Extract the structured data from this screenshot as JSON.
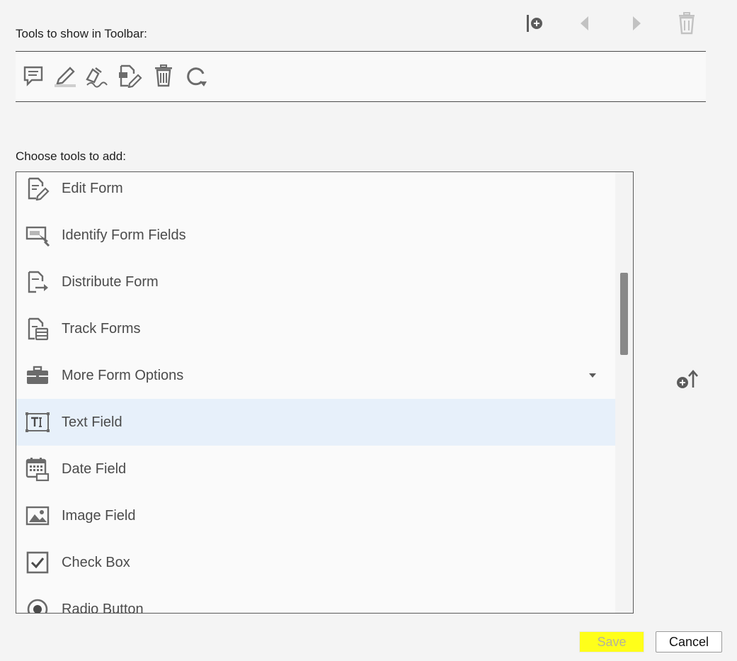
{
  "toolbar_section": {
    "label": "Tools to show in Toolbar:"
  },
  "top_actions": [
    {
      "name": "add-separator-icon",
      "enabled": true
    },
    {
      "name": "move-left-icon",
      "enabled": false
    },
    {
      "name": "move-right-icon",
      "enabled": false
    },
    {
      "name": "delete-icon",
      "enabled": false
    }
  ],
  "toolbar_tools": [
    "comment-icon",
    "highlight-icon",
    "sign-icon",
    "edit-pdf-icon",
    "delete-icon",
    "rotate-icon"
  ],
  "choose_section": {
    "label": "Choose tools to add:"
  },
  "tools": [
    {
      "label": "Edit Form",
      "icon": "edit-form-icon",
      "selected": false
    },
    {
      "label": "Identify Form Fields",
      "icon": "identify-form-fields-icon",
      "selected": false
    },
    {
      "label": "Distribute Form",
      "icon": "distribute-form-icon",
      "selected": false
    },
    {
      "label": "Track Forms",
      "icon": "track-forms-icon",
      "selected": false
    },
    {
      "label": "More Form Options",
      "icon": "briefcase-icon",
      "selected": false,
      "has_dropdown": true
    },
    {
      "label": "Text Field",
      "icon": "text-field-icon",
      "selected": true
    },
    {
      "label": "Date Field",
      "icon": "date-field-icon",
      "selected": false
    },
    {
      "label": "Image Field",
      "icon": "image-field-icon",
      "selected": false
    },
    {
      "label": "Check Box",
      "icon": "checkbox-icon",
      "selected": false
    },
    {
      "label": "Radio Button",
      "icon": "radio-button-icon",
      "selected": false
    }
  ],
  "buttons": {
    "save": "Save",
    "cancel": "Cancel"
  },
  "colors": {
    "icon": "#6b6b6b",
    "icon_disabled": "#c2c2c2",
    "selected_row": "#e7f0fa",
    "save_highlight": "#ffff1a"
  }
}
